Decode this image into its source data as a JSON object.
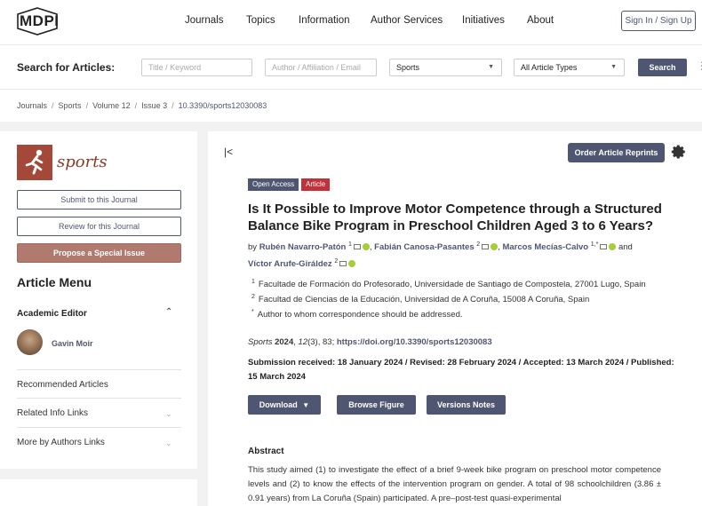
{
  "header": {
    "logo_text": "MDPI",
    "nav": [
      "Journals",
      "Topics",
      "Information",
      "Author Services",
      "Initiatives",
      "About"
    ],
    "signin": "Sign In / Sign Up"
  },
  "search": {
    "label": "Search for Articles:",
    "title_placeholder": "Title / Keyword",
    "author_placeholder": "Author / Affiliation / Email",
    "journal_selected": "Sports",
    "type_selected": "All Article Types",
    "button": "Search"
  },
  "breadcrumb": [
    "Journals",
    "Sports",
    "Volume 12",
    "Issue 3",
    "10.3390/sports12030083"
  ],
  "sidebar": {
    "journal_name": "sports",
    "submit": "Submit to this Journal",
    "review": "Review for this Journal",
    "propose": "Propose a Special Issue",
    "menu_title": "Article Menu",
    "editor_label": "Academic Editor",
    "editor_name": "Gavin Moir",
    "links": [
      "Recommended Articles",
      "Related Info Links",
      "More by Authors Links"
    ]
  },
  "article": {
    "reprints": "Order Article Reprints",
    "badge_open": "Open Access",
    "badge_type": "Article",
    "title": "Is It Possible to Improve Motor Competence through a Structured Balance Bike Program in Preschool Children Aged 3 to 6 Years?",
    "by": "by",
    "authors": [
      {
        "name": "Rubén Navarro-Patón",
        "sup": "1"
      },
      {
        "name": "Fabián Canosa-Pasantes",
        "sup": "2"
      },
      {
        "name": "Marcos Mecías-Calvo",
        "sup": "1,*"
      },
      {
        "name": "Víctor Arufe-Giráldez",
        "sup": "2"
      }
    ],
    "and": "and",
    "affiliations": [
      {
        "sup": "1",
        "text": "Facultade de Formación do Profesorado, Universidade de Santiago de Compostela, 27001 Lugo, Spain"
      },
      {
        "sup": "2",
        "text": "Facultad de Ciencias de la Educación, Universidad de A Coruña, 15008 A Coruña, Spain"
      },
      {
        "sup": "*",
        "text": "Author to whom correspondence should be addressed."
      }
    ],
    "cite_journal": "Sports",
    "cite_year": "2024",
    "cite_volume": "12",
    "cite_rest": "(3), 83;",
    "cite_doi": "https://doi.org/10.3390/sports12030083",
    "dates": "Submission received: 18 January 2024 / Revised: 28 February 2024 / Accepted: 13 March 2024 / Published: 15 March 2024",
    "download": "Download",
    "browse": "Browse Figure",
    "versions": "Versions Notes",
    "abstract_heading": "Abstract",
    "abstract_text": "This study aimed (1) to investigate the effect of a brief 9-week bike program on preschool motor competence levels and (2) to know the effects of the intervention program on gender. A total of 98 schoolchildren (3.86 ± 0.91 years) from La Coruña (Spain) participated. A pre–post-test quasi-experimental"
  }
}
